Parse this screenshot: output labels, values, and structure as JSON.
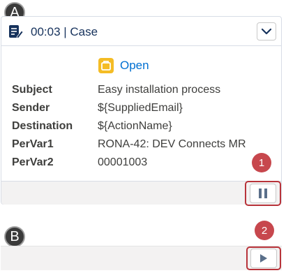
{
  "card": {
    "title": "00:03 | Case",
    "status": "Open",
    "fields": [
      {
        "label": "Subject",
        "value": "Easy installation process"
      },
      {
        "label": "Sender",
        "value": "${SuppliedEmail}"
      },
      {
        "label": "Destination",
        "value": "${ActionName}"
      },
      {
        "label": "PerVar1",
        "value": "RONA-42: DEV Connects MR"
      },
      {
        "label": "PerVar2",
        "value": "00001003"
      }
    ]
  },
  "markers": {
    "a": "A",
    "b": "B",
    "one": "1",
    "two": "2"
  },
  "colors": {
    "accent": "#0070d2",
    "highlight": "#b8333a",
    "marker_red": "#c7474d",
    "status_yellow": "#f4bc25"
  },
  "icons": {
    "case": "case-icon",
    "collapse": "chevron-down-icon",
    "status": "case-status-icon",
    "pause": "pause-icon",
    "play": "play-icon"
  }
}
